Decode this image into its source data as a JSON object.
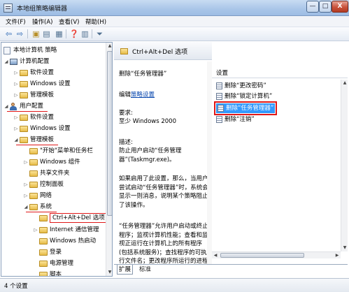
{
  "window": {
    "title": "本地组策略编辑器",
    "controls": {
      "minimize": "—",
      "maximize": "□",
      "close": "X"
    }
  },
  "menubar": {
    "items": [
      "文件(F)",
      "操作(A)",
      "查看(V)",
      "帮助(H)"
    ]
  },
  "toolbar": {
    "icons": [
      "back-arrow-icon",
      "forward-arrow-icon",
      "up-folder-icon",
      "show-tree-icon",
      "export-list-icon",
      "help-icon",
      "properties-icon",
      "filter-icon"
    ],
    "glyphs": [
      "⇦",
      "⇨",
      "▣",
      "▤",
      "▦",
      "❓",
      "▥",
      "⏷"
    ]
  },
  "tree": {
    "root": "本地计算机 策略",
    "computer_config": "计算机配置",
    "software_settings": "软件设置",
    "windows_settings": "Windows 设置",
    "admin_templates": "管理模板",
    "user_config": "用户配置",
    "u_software_settings": "软件设置",
    "u_windows_settings": "Windows 设置",
    "u_admin_templates": "管理模板",
    "start_menu": "\"开始\"菜单和任务栏",
    "windows_components": "Windows 组件",
    "shared_folders": "共享文件夹",
    "control_panel": "控制面板",
    "network": "网络",
    "system": "系统",
    "ctrl_alt_del": "Ctrl+Alt+Del 选项",
    "internet_comm": "Internet 通信管理",
    "windows_hotstart": "Windows 热启动",
    "logon": "登录",
    "power_mgmt": "电源管理",
    "scripts": "脚本"
  },
  "details": {
    "header": "Ctrl+Alt+Del 选项",
    "policy_title": "删除“任务管理器”",
    "edit_prefix": "编辑",
    "edit_link": "策略设置",
    "req_label": "要求:",
    "req_value": "至少 Windows 2000",
    "desc_label": "描述:",
    "desc_value": "防止用户启动“任务管理器”(Taskmgr.exe)。",
    "para1": "如果启用了此设置，那么，当用户尝试启动“任务管理器”时，系统会显示一则消息，说明某个策略阻止了该操作。",
    "para2": "“任务管理器”允许用户启动或终止程序；监视计算机性能；查看和监视正运行在计算机上的所有程序(包括系统服务)；查找程序的可执行文件名；更改程序所运行的进程"
  },
  "list": {
    "column_header": "设置",
    "items": [
      "删除“更改密码”",
      "删除“锁定计算机”",
      "删除“任务管理器”",
      "删除“注销”"
    ],
    "selected_index": 2
  },
  "tabs": [
    "扩展",
    "标准"
  ],
  "status": {
    "text": "4 个设置"
  },
  "colors": {
    "selection": "#3399ff",
    "highlight_box": "#e01818",
    "folder": "#e7bc48"
  }
}
